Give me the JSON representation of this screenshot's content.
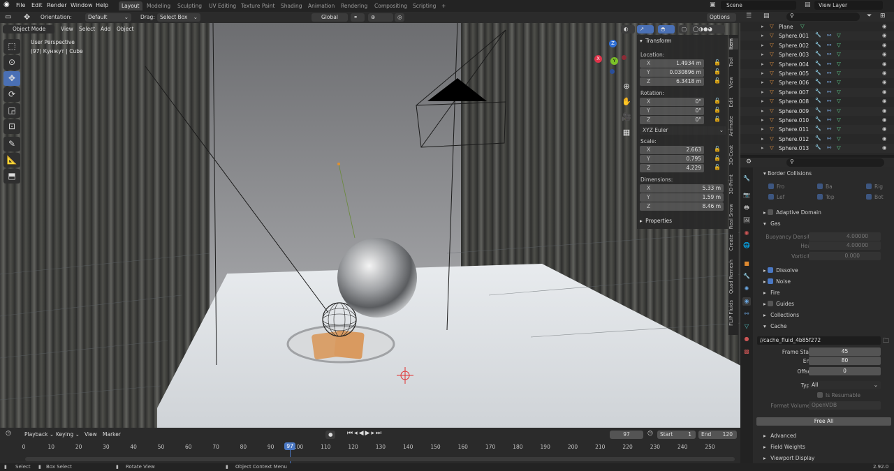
{
  "menu": {
    "file": "File",
    "edit": "Edit",
    "render": "Render",
    "window": "Window",
    "help": "Help"
  },
  "workspaces": [
    "Layout",
    "Modeling",
    "Sculpting",
    "UV Editing",
    "Texture Paint",
    "Shading",
    "Animation",
    "Rendering",
    "Compositing",
    "Scripting"
  ],
  "scene": "Scene",
  "view_layer": "View Layer",
  "tool_header": {
    "orientation_label": "Orientation:",
    "orientation_value": "Default",
    "drag_label": "Drag:",
    "drag_value": "Select Box",
    "transform_orientation": "Global",
    "options": "Options"
  },
  "viewport_header": {
    "mode": "Object Mode",
    "view": "View",
    "select": "Select",
    "add": "Add",
    "object": "Object"
  },
  "viewport": {
    "perspective": "User Perspective",
    "context": "(97) Кунжут | Cube"
  },
  "gizmo": {
    "z": "Z",
    "x": "X",
    "y": "Y"
  },
  "npanel": {
    "title": "Transform",
    "location_label": "Location:",
    "location": [
      {
        "axis": "X",
        "value": "1.4934 m"
      },
      {
        "axis": "Y",
        "value": "0.030896 m"
      },
      {
        "axis": "Z",
        "value": "6.3418 m"
      }
    ],
    "rotation_label": "Rotation:",
    "rotation": [
      {
        "axis": "X",
        "value": "0°"
      },
      {
        "axis": "Y",
        "value": "0°"
      },
      {
        "axis": "Z",
        "value": "0°"
      }
    ],
    "rotation_mode": "XYZ Euler",
    "scale_label": "Scale:",
    "scale": [
      {
        "axis": "X",
        "value": "2.663"
      },
      {
        "axis": "Y",
        "value": "0.795"
      },
      {
        "axis": "Z",
        "value": "4.229"
      }
    ],
    "dimensions_label": "Dimensions:",
    "dimensions": [
      {
        "axis": "X",
        "value": "5.33 m"
      },
      {
        "axis": "Y",
        "value": "1.59 m"
      },
      {
        "axis": "Z",
        "value": "8.46 m"
      }
    ],
    "properties": "Properties"
  },
  "side_tabs": [
    "Item",
    "Tool",
    "View",
    "Edit",
    "Animate",
    "3D-Coat",
    "3D-Print",
    "Real Snow",
    "Create",
    "Quad Remesh",
    "FLIP Fluids"
  ],
  "outliner": [
    "Plane",
    "Sphere.001",
    "Sphere.002",
    "Sphere.003",
    "Sphere.004",
    "Sphere.005",
    "Sphere.006",
    "Sphere.007",
    "Sphere.008",
    "Sphere.009",
    "Sphere.010",
    "Sphere.011",
    "Sphere.012",
    "Sphere.013"
  ],
  "properties": {
    "border_collisions": "Border Collisions",
    "border": [
      "Fro",
      "Ba",
      "Rig",
      "Lef",
      "Top",
      "Bot"
    ],
    "adaptive_domain": "Adaptive Domain",
    "gas": "Gas",
    "buoyancy_label": "Buoyancy Density",
    "buoyancy": "4.00000",
    "heat_label": "Heat",
    "heat": "4.00000",
    "vorticity_label": "Vorticity",
    "vorticity": "0.000",
    "dissolve": "Dissolve",
    "noise": "Noise",
    "fire": "Fire",
    "guides": "Guides",
    "collections": "Collections",
    "cache": "Cache",
    "cache_path": "//cache_fluid_4b85f272",
    "frame_start_label": "Frame Start",
    "frame_start": "45",
    "end_label": "End",
    "end": "80",
    "offset_label": "Offset",
    "offset": "0",
    "type_label": "Type",
    "type": "All",
    "resumable": "Is Resumable",
    "format_label": "Format Volumes",
    "format": "OpenVDB",
    "free_all": "Free All",
    "advanced": "Advanced",
    "field_weights": "Field Weights",
    "viewport_display": "Viewport Display"
  },
  "timeline": {
    "playback": "Playback",
    "keying": "Keying",
    "view": "View",
    "marker": "Marker",
    "current_frame": "97",
    "start_label": "Start",
    "start": "1",
    "end_label": "End",
    "end": "120",
    "ticks": [
      "0",
      "10",
      "20",
      "30",
      "40",
      "50",
      "60",
      "70",
      "80",
      "90",
      "100",
      "110",
      "120",
      "130",
      "140",
      "150",
      "160",
      "170",
      "180",
      "190",
      "200",
      "210",
      "220",
      "230",
      "240",
      "250"
    ]
  },
  "status": {
    "select": "Select",
    "box_select": "Box Select",
    "rotate_view": "Rotate View",
    "object_context": "Object Context Menu",
    "version": "2.92.0"
  }
}
